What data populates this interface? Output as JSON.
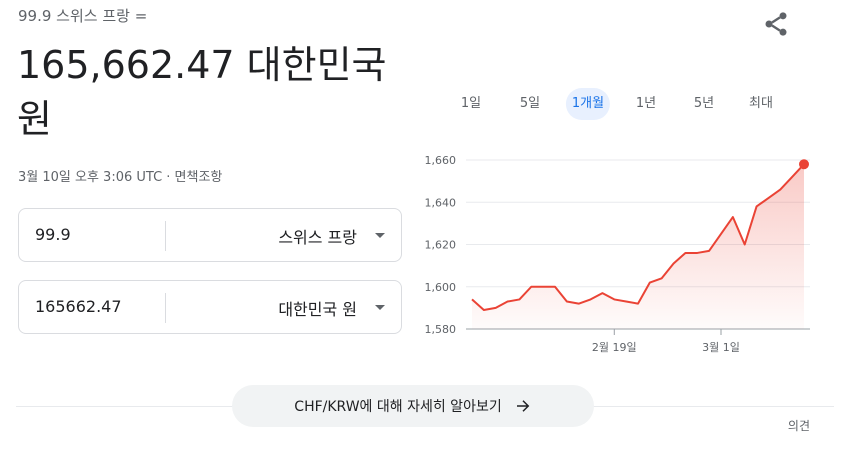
{
  "header": {
    "subtitle": "99.9 스위스 프랑 =",
    "result_line1": "165,662.47 대한민국",
    "result_line2": "원",
    "timestamp": "3월 10일 오후 3:06 UTC · 면책조항",
    "share_icon": "share-icon"
  },
  "converter": {
    "from": {
      "amount": "99.9",
      "currency": "스위스 프랑"
    },
    "to": {
      "amount": "165662.47",
      "currency": "대한민국 원"
    }
  },
  "ranges": [
    "1일",
    "5일",
    "1개월",
    "1년",
    "5년",
    "최대"
  ],
  "active_range": "1개월",
  "chart_data": {
    "type": "area",
    "title": "",
    "xlabel": "",
    "ylabel": "",
    "ylim": [
      1580,
      1660
    ],
    "yticks": [
      1580,
      1600,
      1620,
      1640,
      1660
    ],
    "yticklabels": [
      "1,580",
      "1,600",
      "1,620",
      "1,640",
      "1,660"
    ],
    "xticks": [
      {
        "x": 12,
        "label": "2월 19일"
      },
      {
        "x": 21,
        "label": "3월 1일"
      }
    ],
    "grid": true,
    "line_color": "#ea4335",
    "series": [
      {
        "values": [
          1594,
          1589,
          1590,
          1593,
          1594,
          1600,
          1600,
          1600,
          1593,
          1592,
          1594,
          1597,
          1594,
          1593,
          1592,
          1602,
          1604,
          1611,
          1616,
          1616,
          1617,
          1625,
          1633,
          1620,
          1638,
          1642,
          1646,
          1652,
          1658
        ]
      }
    ]
  },
  "cta": {
    "label": "CHF/KRW에 대해 자세히 알아보기"
  },
  "feedback": "의견"
}
